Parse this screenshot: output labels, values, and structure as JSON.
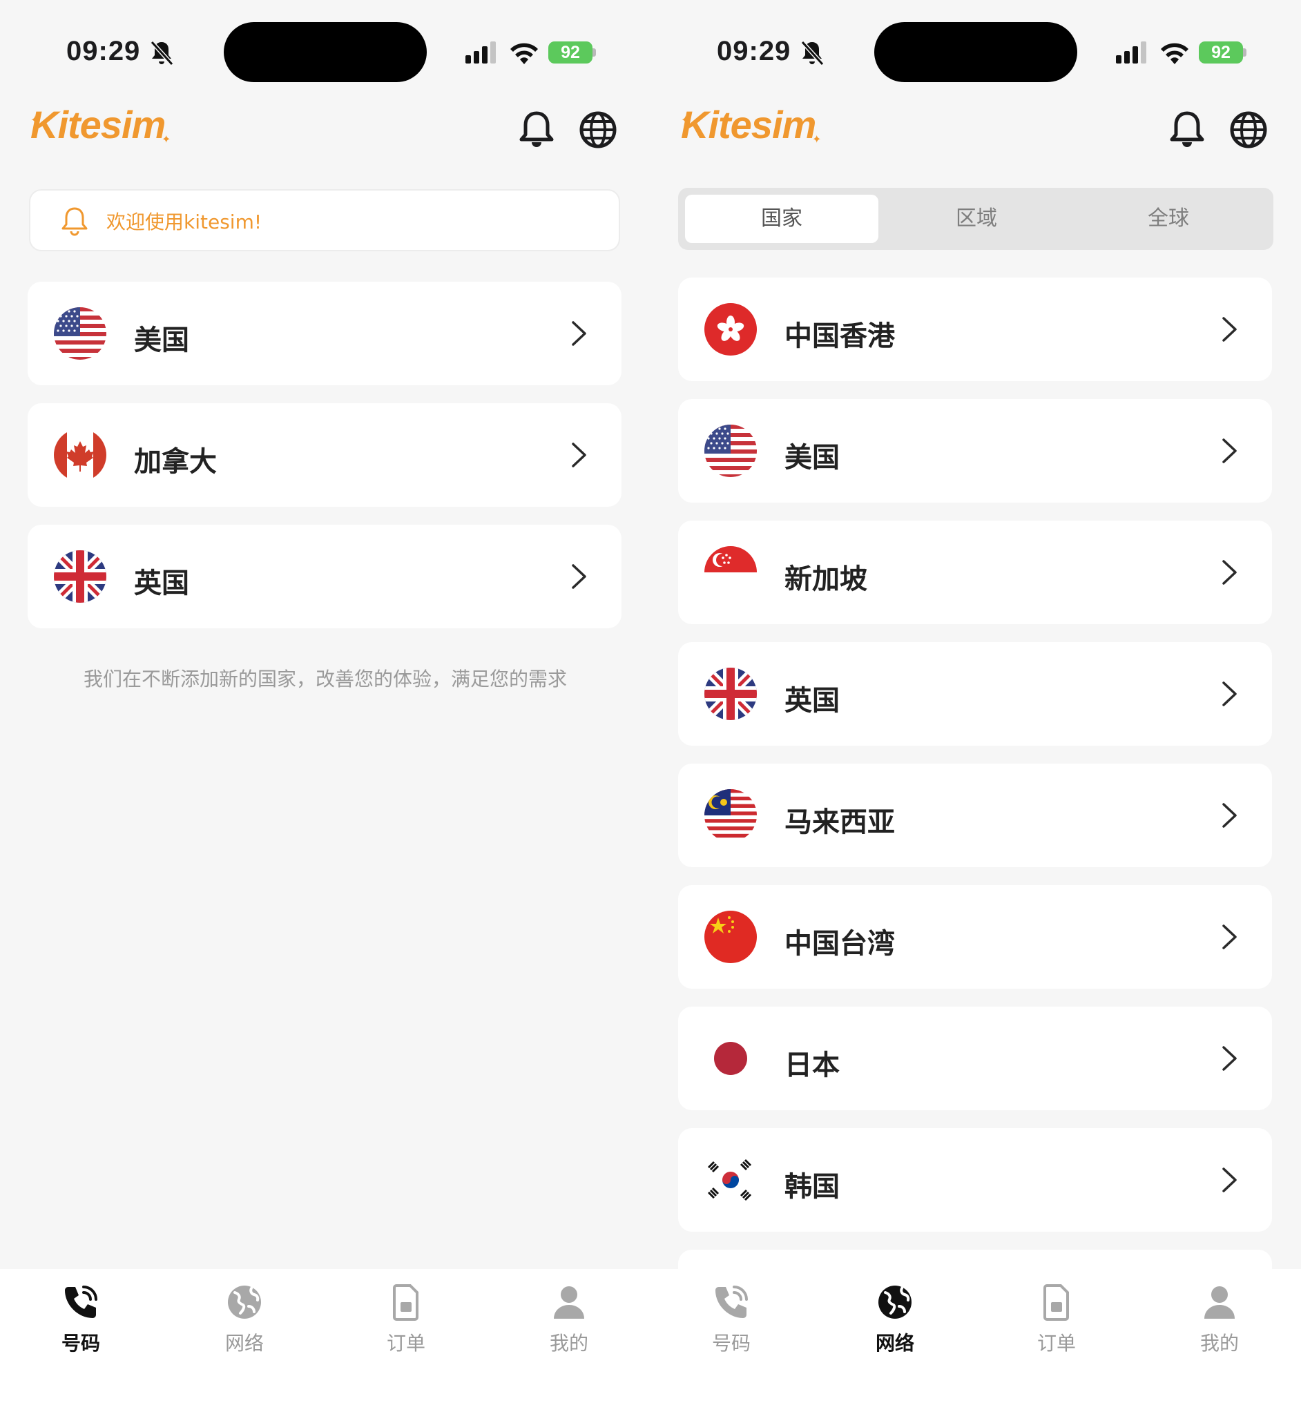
{
  "status_bar": {
    "time": "09:29",
    "battery": "92"
  },
  "header": {
    "logo": "Kitesim"
  },
  "notice": {
    "text": "欢迎使用kitesim!"
  },
  "left_list": [
    {
      "label": "美国",
      "flag": "us-flag"
    },
    {
      "label": "加拿大",
      "flag": "canada-flag"
    },
    {
      "label": "英国",
      "flag": "uk-flag"
    }
  ],
  "footer_note": "我们在不断添加新的国家，改善您的体验，满足您的需求",
  "segmented": {
    "tabs": [
      "国家",
      "区域",
      "全球"
    ],
    "selected": "国家"
  },
  "right_list": [
    {
      "label": "中国香港",
      "flag": "hong-kong-flag"
    },
    {
      "label": "美国",
      "flag": "us-flag"
    },
    {
      "label": "新加坡",
      "flag": "singapore-flag"
    },
    {
      "label": "英国",
      "flag": "uk-flag"
    },
    {
      "label": "马来西亚",
      "flag": "malaysia-flag"
    },
    {
      "label": "中国台湾",
      "flag": "china-flag"
    },
    {
      "label": "日本",
      "flag": "japan-flag"
    },
    {
      "label": "韩国",
      "flag": "korea-flag"
    }
  ],
  "tabbar": {
    "items": [
      {
        "label": "号码",
        "icon": "phone-icon"
      },
      {
        "label": "网络",
        "icon": "globe-icon"
      },
      {
        "label": "订单",
        "icon": "sim-card-icon"
      },
      {
        "label": "我的",
        "icon": "person-icon"
      }
    ],
    "active_left": "号码",
    "active_right": "网络"
  },
  "colors": {
    "brand": "#f0982f",
    "battery": "#5cc95c",
    "background": "#f6f6f6"
  }
}
